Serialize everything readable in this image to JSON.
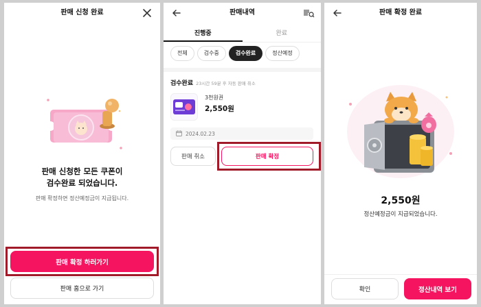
{
  "screen1": {
    "title": "판매 신청 완료",
    "headline_line1": "판매 신청한 모든 쿠폰이",
    "headline_line2": "검수완료 되었습니다.",
    "subtext": "판매 확정하면 정산예정금이 지급됩니다.",
    "primary_button": "판매 확정 하러가기",
    "secondary_button": "판매 홈으로 가기"
  },
  "screen2": {
    "title": "판매내역",
    "tabs": [
      "진행중",
      "완료"
    ],
    "filters": [
      "전체",
      "검수중",
      "검수완료",
      "정산예정"
    ],
    "active_filter_index": 2,
    "status_title": "검수완료",
    "status_note": "23시간 59분 후 자동 판매 취소",
    "product_name": "3천원권",
    "product_price": "2,550원",
    "date": "2024.02.23",
    "cancel_button": "판매 취소",
    "confirm_button": "판매 확정"
  },
  "screen3": {
    "title": "판매 확정 완료",
    "amount": "2,550원",
    "amount_note": "정산예정금이 지급되었습니다.",
    "confirm_button": "확인",
    "history_button": "정산내역 보기"
  },
  "colors": {
    "accent": "#f5145f",
    "highlight_frame": "#a01a2a",
    "chip_active": "#222222"
  },
  "icons": {
    "close": "close-icon",
    "back": "back-arrow-icon",
    "barcode_search": "barcode-search-icon",
    "calendar": "calendar-icon"
  }
}
